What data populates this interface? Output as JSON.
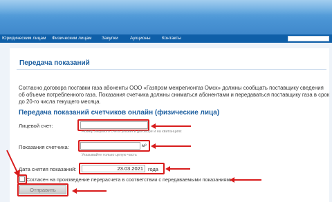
{
  "nav": {
    "items": [
      "Юридическим лицам",
      "Физическим лицам",
      "Закупки",
      "Аукционы",
      "Контакты"
    ]
  },
  "page": {
    "title": "Передача показаний",
    "intro": "Согласно договора поставки газа абоненты ООО «Газпром межрегионгаз Омск» должны сообщать поставщику сведения об объеме потребленного газа. Показания счетчика должны сниматься абонентами и передаваться поставщику газа в срок до 20-го числа текущего месяца."
  },
  "form": {
    "section_title": "Передача показаний счетчиков онлайн (физические лица)",
    "account_label": "Лицевой счет:",
    "account_value": "",
    "account_hint": "Номер лицевого счета указан в договоре и на квитанциях",
    "reading_label": "Показания счетчика:",
    "reading_value": "",
    "reading_unit": "м³",
    "reading_hint": "Указывайте только целую часть",
    "date_label": "Дата снятия показаний:",
    "date_value": "23.03.2021",
    "date_unit": "года",
    "consent_label": "Согласен на произведение перерасчета в соответствии с передаваемыми показаниями",
    "consent_checked": false,
    "submit_label": "Отправить"
  },
  "colors": {
    "header_blue": "#4a94d4",
    "nav_blue": "#0f5fa8",
    "title_blue": "#1d5fa0",
    "annotation_red": "#d81c1c"
  }
}
